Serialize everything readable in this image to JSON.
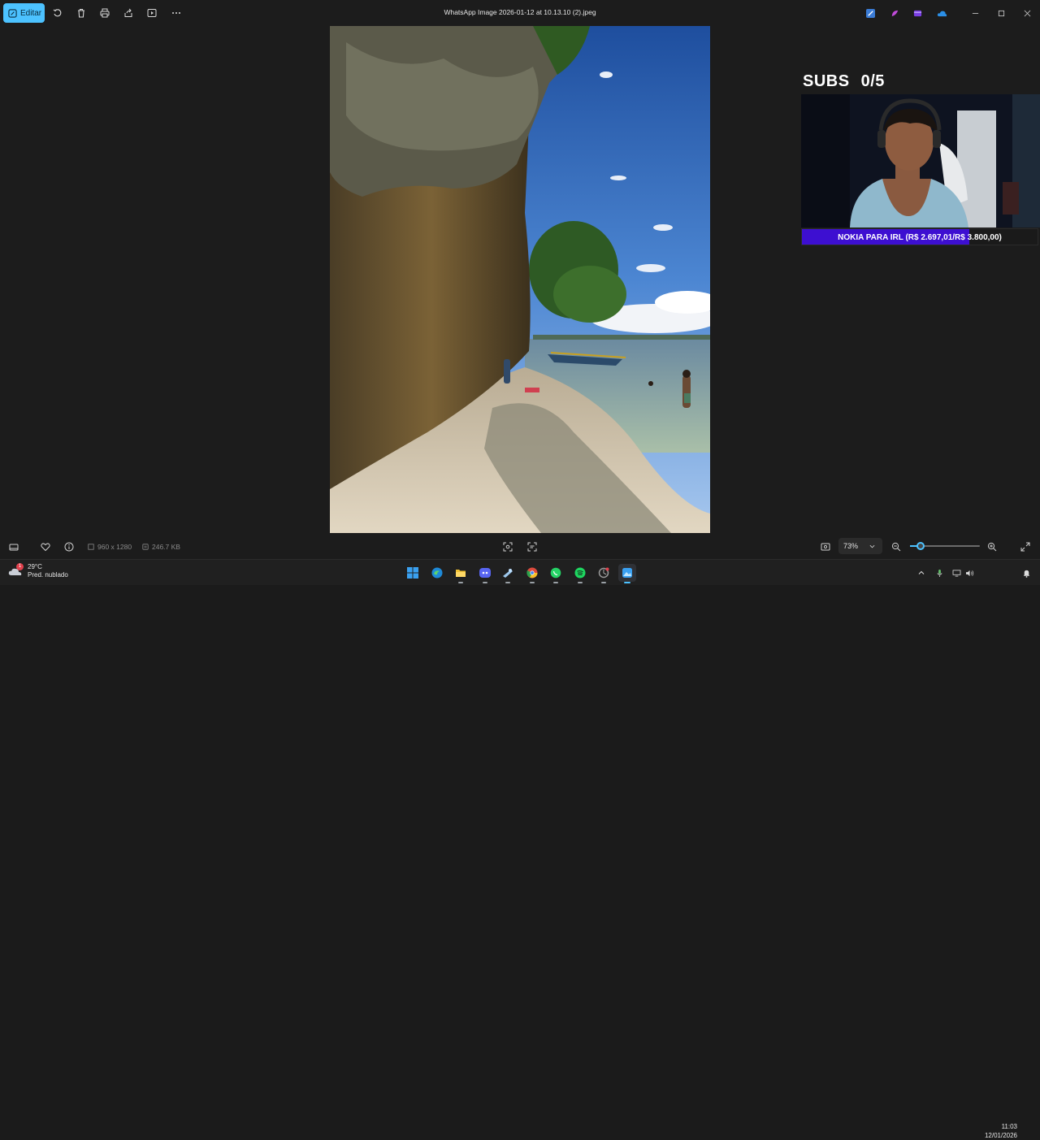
{
  "toolbar": {
    "edit_label": "Editar",
    "file_title": "WhatsApp Image 2026-01-12 at 10.13.10 (2).jpeg",
    "icons": [
      "rotate-icon",
      "delete-icon",
      "print-icon",
      "share-icon",
      "slideshow-icon",
      "more-icon"
    ]
  },
  "overlay": {
    "subs_label": "SUBS",
    "subs_count": "0/5",
    "goal_text": "NOKIA PARA IRL (R$ 2.697,01/R$ 3.800,00)",
    "goal_progress": 0.7097,
    "goal_color": "#3d0fd1"
  },
  "bottombar": {
    "dimensions": "960 x 1280",
    "file_size": "246.7 KB",
    "zoom": "73%",
    "zoom_level": 0.15
  },
  "taskbar": {
    "weather_temp": "29°C",
    "weather_desc": "Pred. nublado",
    "weather_badge": "1",
    "time": "11:03",
    "date": "12/01/2026",
    "apps": [
      "windows-start",
      "edge",
      "file-explorer",
      "discord",
      "steam",
      "chrome",
      "whatsapp",
      "spotify",
      "app-tool",
      "photos"
    ]
  },
  "colors": {
    "accent": "#4cc2ff",
    "background": "#1c1c1c"
  }
}
